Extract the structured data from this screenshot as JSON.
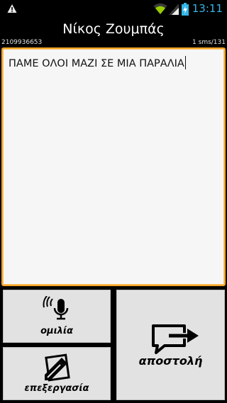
{
  "status_bar": {
    "time": "13:11",
    "icons": [
      "warning-icon",
      "wifi-icon",
      "signal-icon",
      "battery-charging-icon"
    ],
    "accent_color": "#33b5e5"
  },
  "header": {
    "contact_name": "Νίκος Ζουμπάς",
    "phone_number": "2109936653",
    "sms_counter": "1 sms/131"
  },
  "message": {
    "text": "ΠΑΜΕ ΟΛΟΙ ΜΑΖΙ ΣΕ ΜΙΑ ΠΑΡΑΛΙΑ",
    "border_color": "#f5a623"
  },
  "buttons": {
    "speech_label": "ομιλία",
    "edit_label": "επεξεργασία",
    "send_label": "αποστολή"
  }
}
